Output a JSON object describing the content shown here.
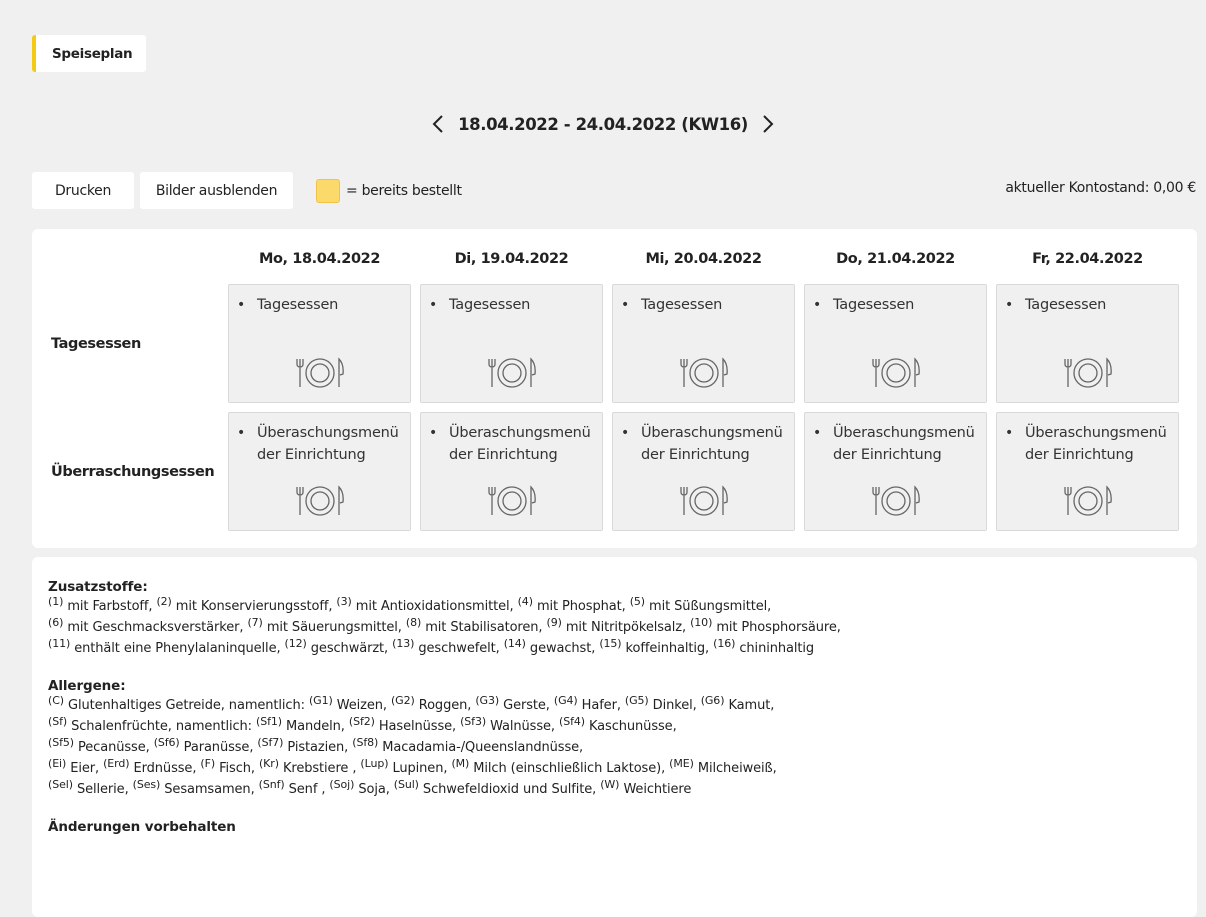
{
  "tab": {
    "title": "Speiseplan"
  },
  "week": {
    "label": "18.04.2022 - 24.04.2022 (KW16)"
  },
  "toolbar": {
    "print_label": "Drucken",
    "hide_images_label": "Bilder ausblenden",
    "legend_text": "= bereits bestellt",
    "legend_color": "#fbd96a",
    "balance": "aktueller Kontostand: 0,00 €"
  },
  "colors": {
    "accent": "#f3cb16"
  },
  "menu": {
    "days": [
      "Mo, 18.04.2022",
      "Di, 19.04.2022",
      "Mi, 20.04.2022",
      "Do, 21.04.2022",
      "Fr, 22.04.2022"
    ],
    "rows": [
      {
        "label": "Tagesessen",
        "bullet": "•",
        "items": [
          "Tagesessen",
          "Tagesessen",
          "Tagesessen",
          "Tagesessen",
          "Tagesessen"
        ],
        "icon": "plate-cutlery-icon"
      },
      {
        "label": "Überraschungsessen",
        "bullet": "•",
        "items": [
          "Überaschungsmenü der Einrichtung",
          "Überaschungsmenü der Einrichtung",
          "Überaschungsmenü der Einrichtung",
          "Überaschungsmenü der Einrichtung",
          "Überaschungsmenü der Einrichtung"
        ],
        "icon": "plate-cutlery-icon"
      }
    ]
  },
  "info": {
    "additives_title": "Zusatzstoffe:",
    "additives_lines": [
      [
        [
          "(1)",
          "mit Farbstoff,"
        ],
        [
          "(2)",
          "mit Konservierungsstoff,"
        ],
        [
          "(3)",
          "mit Antioxidationsmittel,"
        ],
        [
          "(4)",
          "mit Phosphat,"
        ],
        [
          "(5)",
          "mit Süßungsmittel,"
        ]
      ],
      [
        [
          "(6)",
          "mit Geschmacksverstärker,"
        ],
        [
          "(7)",
          "mit Säuerungsmittel,"
        ],
        [
          "(8)",
          "mit Stabilisatoren,"
        ],
        [
          "(9)",
          "mit Nitritpökelsalz,"
        ],
        [
          "(10)",
          "mit Phosphorsäure,"
        ]
      ],
      [
        [
          "(11)",
          "enthält eine Phenylalaninquelle,"
        ],
        [
          "(12)",
          "geschwärzt,"
        ],
        [
          "(13)",
          "geschwefelt,"
        ],
        [
          "(14)",
          "gewachst,"
        ],
        [
          "(15)",
          "koffeinhaltig,"
        ],
        [
          "(16)",
          "chininhaltig"
        ]
      ]
    ],
    "allergens_title": "Allergene:",
    "allergens_lines": [
      [
        [
          "(C)",
          "Glutenhaltiges Getreide, namentlich:"
        ],
        [
          "(G1)",
          "Weizen,"
        ],
        [
          "(G2)",
          "Roggen,"
        ],
        [
          "(G3)",
          "Gerste,"
        ],
        [
          "(G4)",
          "Hafer,"
        ],
        [
          "(G5)",
          "Dinkel,"
        ],
        [
          "(G6)",
          "Kamut,"
        ]
      ],
      [
        [
          "(Sf)",
          "Schalenfrüchte, namentlich:"
        ],
        [
          "(Sf1)",
          "Mandeln,"
        ],
        [
          "(Sf2)",
          "Haselnüsse,"
        ],
        [
          "(Sf3)",
          "Walnüsse,"
        ],
        [
          "(Sf4)",
          "Kaschunüsse,"
        ]
      ],
      [
        [
          "(Sf5)",
          "Pecanüsse,"
        ],
        [
          "(Sf6)",
          "Paranüsse,"
        ],
        [
          "(Sf7)",
          "Pistazien,"
        ],
        [
          "(Sf8)",
          "Macadamia-/Queenslandnüsse,"
        ]
      ],
      [
        [
          "(Ei)",
          "Eier,"
        ],
        [
          "(Erd)",
          "Erdnüsse,"
        ],
        [
          "(F)",
          "Fisch,"
        ],
        [
          "(Kr)",
          "Krebstiere ,"
        ],
        [
          "(Lup)",
          "Lupinen,"
        ],
        [
          "(M)",
          "Milch (einschließlich Laktose),"
        ],
        [
          "(ME)",
          "Milcheiweiß,"
        ]
      ],
      [
        [
          "(Sel)",
          "Sellerie,"
        ],
        [
          "(Ses)",
          "Sesamsamen,"
        ],
        [
          "(Snf)",
          "Senf ,"
        ],
        [
          "(Soj)",
          "Soja,"
        ],
        [
          "(Sul)",
          "Schwefeldioxid und Sulfite,"
        ],
        [
          "(W)",
          "Weichtiere"
        ]
      ]
    ],
    "note": "Änderungen vorbehalten"
  }
}
